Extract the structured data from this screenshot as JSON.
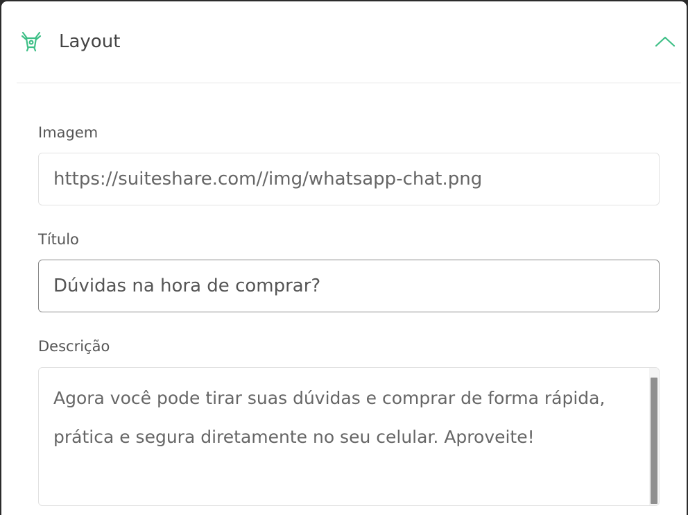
{
  "section": {
    "title": "Layout",
    "icon": "layout-icon",
    "collapse_icon": "chevron-up-icon",
    "accent_color": "#3dbf86"
  },
  "fields": {
    "image": {
      "label": "Imagem",
      "value": "https://suiteshare.com//img/whatsapp-chat.png"
    },
    "title": {
      "label": "Título",
      "value": "Dúvidas na hora de comprar?"
    },
    "description": {
      "label": "Descrição",
      "value": "Agora você pode tirar suas dúvidas e comprar de forma rápida, prática e segura diretamente no seu celular. Aproveite!"
    }
  }
}
